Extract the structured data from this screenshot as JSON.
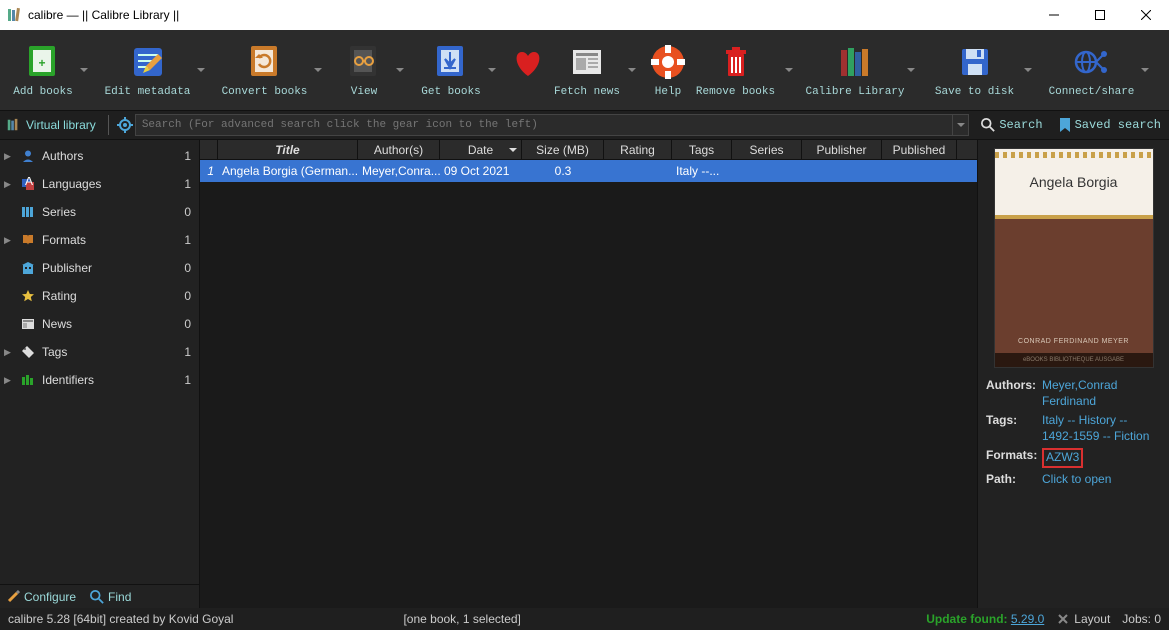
{
  "window": {
    "title": "calibre — || Calibre Library ||"
  },
  "toolbar": [
    {
      "id": "add-books",
      "label": "Add books"
    },
    {
      "id": "edit-metadata",
      "label": "Edit metadata"
    },
    {
      "id": "convert-books",
      "label": "Convert books"
    },
    {
      "id": "view",
      "label": "View"
    },
    {
      "id": "get-books",
      "label": "Get books"
    },
    {
      "id": "fetch-news",
      "label": "Fetch news"
    },
    {
      "id": "help",
      "label": "Help"
    },
    {
      "id": "remove-books",
      "label": "Remove books"
    },
    {
      "id": "calibre-library",
      "label": "Calibre Library"
    },
    {
      "id": "save-to-disk",
      "label": "Save to disk"
    },
    {
      "id": "connect-share",
      "label": "Connect/share"
    }
  ],
  "secondbar": {
    "virtual_library": "Virtual library",
    "search_placeholder": "Search (For advanced search click the gear icon to the left)",
    "search_label": "Search",
    "saved_search_label": "Saved search"
  },
  "sidebar": [
    {
      "icon": "user",
      "label": "Authors",
      "count": "1",
      "expandable": true
    },
    {
      "icon": "lang",
      "label": "Languages",
      "count": "1",
      "expandable": true
    },
    {
      "icon": "series",
      "label": "Series",
      "count": "0",
      "expandable": false
    },
    {
      "icon": "formats",
      "label": "Formats",
      "count": "1",
      "expandable": true
    },
    {
      "icon": "publisher",
      "label": "Publisher",
      "count": "0",
      "expandable": false
    },
    {
      "icon": "rating",
      "label": "Rating",
      "count": "0",
      "expandable": false
    },
    {
      "icon": "news",
      "label": "News",
      "count": "0",
      "expandable": false
    },
    {
      "icon": "tags",
      "label": "Tags",
      "count": "1",
      "expandable": true
    },
    {
      "icon": "identifiers",
      "label": "Identifiers",
      "count": "1",
      "expandable": true
    }
  ],
  "columns": [
    "Title",
    "Author(s)",
    "Date",
    "Size (MB)",
    "Rating",
    "Tags",
    "Series",
    "Publisher",
    "Published"
  ],
  "rows": [
    {
      "num": "1",
      "title": "Angela Borgia (German...",
      "author": "Meyer,Conra...",
      "date": "09 Oct 2021",
      "size": "0.3",
      "rating": "",
      "tags": "Italy --...",
      "series": "",
      "publisher": "",
      "published": ""
    }
  ],
  "detail": {
    "cover_title": "Angela Borgia",
    "cover_author": "CONRAD FERDINAND MEYER",
    "cover_strip": "eBOOKS BIBLIOTHEQUE AUSGABE",
    "authors_label": "Authors:",
    "authors_value": "Meyer,Conrad Ferdinand",
    "tags_label": "Tags:",
    "tags_value": "Italy -- History -- 1492-1559 -- Fiction",
    "formats_label": "Formats:",
    "formats_value": "AZW3",
    "path_label": "Path:",
    "path_value": "Click to open"
  },
  "bottombar": {
    "configure": "Configure",
    "find": "Find"
  },
  "statusbar": {
    "left": "calibre 5.28 [64bit] created by Kovid Goyal",
    "mid": "[one book, 1 selected]",
    "update_label": "Update found:",
    "update_version": "5.29.0",
    "layout": "Layout",
    "jobs": "Jobs: 0"
  },
  "colors": {
    "accent": "#3874d1",
    "link": "#4da6d9",
    "mono": "#9bdada"
  }
}
